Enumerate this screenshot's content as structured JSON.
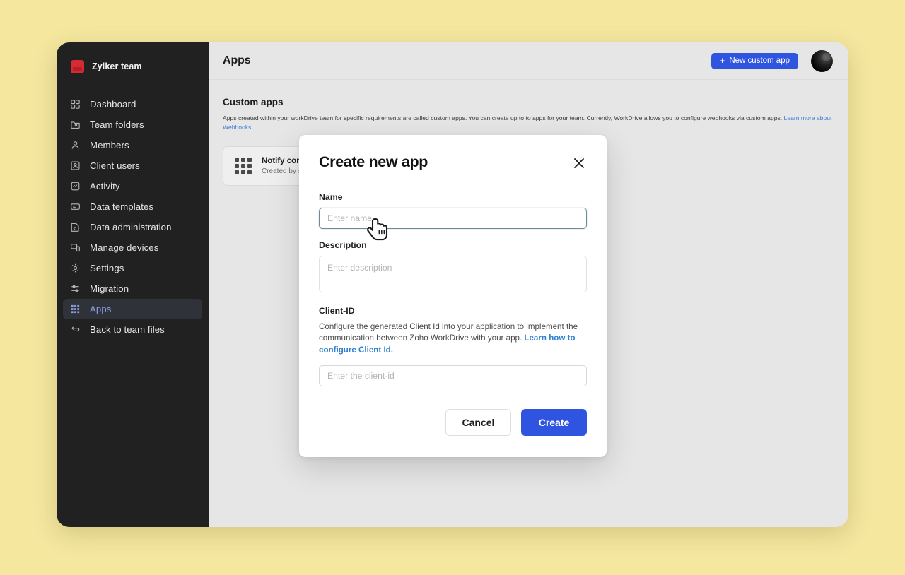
{
  "sidebar": {
    "team_name": "Zylker team",
    "team_logo_icon": "zylker-logo",
    "items": [
      {
        "label": "Dashboard",
        "icon": "dashboard-grid-icon",
        "active": false
      },
      {
        "label": "Team folders",
        "icon": "folder-icon",
        "active": false
      },
      {
        "label": "Members",
        "icon": "members-icon",
        "active": false
      },
      {
        "label": "Client users",
        "icon": "client-users-icon",
        "active": false
      },
      {
        "label": "Activity",
        "icon": "activity-icon",
        "active": false
      },
      {
        "label": "Data templates",
        "icon": "data-templates-icon",
        "active": false
      },
      {
        "label": "Data administration",
        "icon": "data-administration-icon",
        "active": false
      },
      {
        "label": "Manage devices",
        "icon": "manage-devices-icon",
        "active": false
      },
      {
        "label": "Settings",
        "icon": "gear-icon",
        "active": false
      },
      {
        "label": "Migration",
        "icon": "migration-icon",
        "active": false
      },
      {
        "label": "Apps",
        "icon": "apps-grid-icon",
        "active": true
      },
      {
        "label": "Back to team files",
        "icon": "back-arrow-icon",
        "active": false
      }
    ]
  },
  "topbar": {
    "title": "Apps",
    "new_app_label": "New custom app",
    "new_app_plus": "+",
    "avatar_icon": "user-avatar"
  },
  "content": {
    "section_title": "Custom apps",
    "description_part1": "Apps created within your workDrive team for specific requirements are called custom apps. You can create up to to apps for your team. Currently, WorkDrive allows you to configure webhooks via custom apps. ",
    "description_link": "Learn more about Webhooks.",
    "card": {
      "icon": "apps-grid-icon",
      "title": "Notify connector",
      "subtitle": "Created by sales team"
    }
  },
  "modal": {
    "title": "Create new app",
    "close_icon": "close-icon",
    "name_label": "Name",
    "name_value": "",
    "name_placeholder": "Enter name",
    "description_label": "Description",
    "description_value": "",
    "description_placeholder": "Enter description",
    "client_id_label": "Client-ID",
    "client_id_help": "Configure the generated Client Id into your application to implement the communication between Zoho WorkDrive with your app. ",
    "client_id_help_link": "Learn how to configure Client Id.",
    "client_id_value": "",
    "client_id_placeholder": "Enter the client-id",
    "cancel_label": "Cancel",
    "create_label": "Create"
  },
  "colors": {
    "page_background": "#f5e79e",
    "sidebar_background": "#212121",
    "main_background": "#e6e6e6",
    "accent_blue": "#2f55e0",
    "active_nav_text": "#8b9ee0",
    "link_blue": "#3b7fd4",
    "logo_red": "#d62b34"
  },
  "cursor": {
    "icon": "pointer-hand-cursor"
  }
}
